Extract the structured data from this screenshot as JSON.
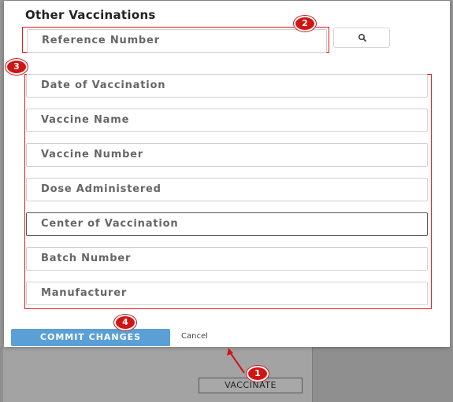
{
  "background": {
    "vaccinate_label": "VACCINATE"
  },
  "modal": {
    "title": "Other Vaccinations",
    "reference_placeholder": "Reference Number",
    "fields": [
      "Date of Vaccination",
      "Vaccine Name",
      "Vaccine Number",
      "Dose Administered",
      "Center of Vaccination",
      "Batch Number",
      "Manufacturer"
    ],
    "commit_label": "COMMIT CHANGES",
    "cancel_label": "Cancel"
  },
  "annotations": {
    "badge_1": "1",
    "badge_2": "2",
    "badge_3": "3",
    "badge_4": "4"
  },
  "colors": {
    "highlight": "#e21b1b",
    "badge": "#d11414",
    "primary_button": "#5aa0d6"
  },
  "icons": {
    "search": "search-icon",
    "arrow": "arrow-icon"
  }
}
